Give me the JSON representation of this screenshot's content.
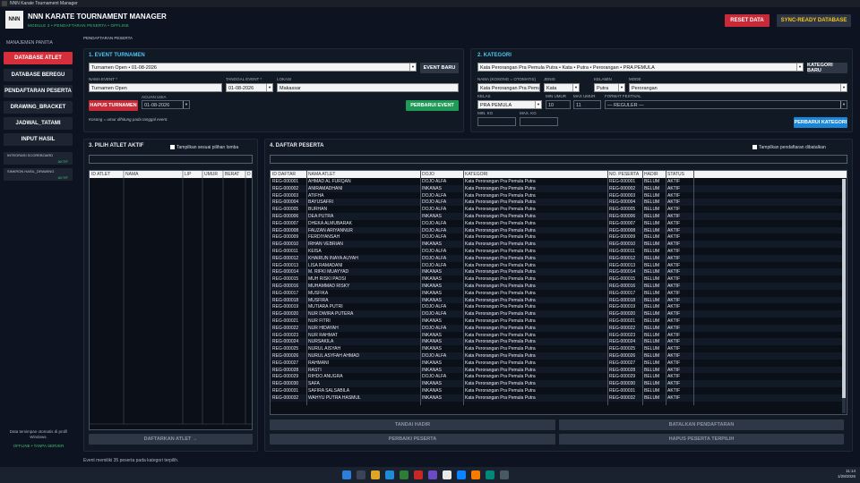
{
  "window_title": "NNN Karate Tournament Manager",
  "logo_text": "NNN",
  "app_title": "NNN KARATE TOURNAMENT MANAGER",
  "app_subtitle": "MODULE 3 • PENDAFTARAN PESERTA • OFFLINE",
  "header_buttons": {
    "reset": "RESET DATA",
    "sync": "SYNC-READY DATABASE"
  },
  "sidebar": {
    "section": "MANAJEMEN PANITIA",
    "items": [
      "DATABASE ATLET",
      "DATABASE BEREGU",
      "PENDAFTARAN PESERTA",
      "DRAWING_BRACKET",
      "JADWAL_TATAMI",
      "INPUT HASIL"
    ],
    "small_items": [
      {
        "label": "INTEGRASI SCOREBOARD",
        "status": "AKTIF"
      },
      {
        "label": "SINKRON HASIL_DRAWING",
        "status": "AKTIF"
      }
    ],
    "footer": "Data tersimpan otomatis di profil Windows.",
    "footer_status": "OFFLINE • TANPA SERVER"
  },
  "breadcrumb": "PENDAFTARAN PESERTA",
  "event": {
    "title": "1. EVENT TURNAMEN",
    "selected": "Turnamen Open • 01-08-2026",
    "btn_new": "EVENT BARU",
    "lbl_name": "NAMA EVENT *",
    "lbl_date": "TANGGAL EVENT *",
    "lbl_loc": "LOKASI",
    "name": "Turnamen Open",
    "date": "01-08-2026",
    "location": "Makassar",
    "btn_delete": "HAPUS TURNAMEN",
    "lbl_age": "ACUAN USIA",
    "age_ref": "01-08-2026",
    "btn_update": "PERBARUI EVENT",
    "hint": "Kosong = umur dihitung pada tanggal event."
  },
  "kategori": {
    "title": "2. KATEGORI",
    "selected": "Kata Perorangan Pra Pemula Putra • Kata • Putra • Perorangan • PRA PEMULA",
    "btn_new": "KATEGORI BARU",
    "lbl_name": "NAMA (KOSONG = OTOMATIS)",
    "lbl_type": "JENIS",
    "lbl_gender": "KELAMIN",
    "lbl_mode": "MODE",
    "name": "Kata Perorangan Pra Pemula",
    "type": "Kata",
    "gender": "Putra",
    "mode": "Perorangan",
    "lbl_kelas": "KELAS",
    "lbl_min_age": "MIN UMUR",
    "lbl_max_age": "MAX UMUR",
    "lbl_format": "FORMAT FESTIVAL",
    "kelas": "PRA PEMULA",
    "min_age": "10",
    "max_age": "11",
    "format": "— REGULER —",
    "lbl_min_kg": "MIN. KG",
    "lbl_max_kg": "MAX. KG",
    "btn_update": "PERBARUI KATEGORI"
  },
  "pilih": {
    "title": "3. PILIH ATLET AKTIF",
    "check_label": "Tampilkan sesuai pilihan lomba",
    "columns": [
      "ID ATLET",
      "NAMA",
      "L/P",
      "UMUR",
      "BERAT",
      "D"
    ],
    "btn_register": "DAFTARKAN ATLET →"
  },
  "daftar": {
    "title": "4. DAFTAR PESERTA",
    "check_label": "Tampilkan pendaftaran dibatalkan",
    "columns": [
      "ID DAFTAR",
      "NAMA ATLET",
      "DOJO",
      "KATEGORI",
      "NO. PESERTA",
      "HADIR",
      "STATUS"
    ],
    "rows": [
      [
        "REG-000001",
        "AHMAD AL FURQAN",
        "DOJO ALFA",
        "Kata Perorangan Pra Pemula Putra",
        "REG-000001",
        "BELUM",
        "AKTIF"
      ],
      [
        "REG-000002",
        "ANIRAMADHANI",
        "INKANAS",
        "Kata Perorangan Pra Pemula Putra",
        "REG-000002",
        "BELUM",
        "AKTIF"
      ],
      [
        "REG-000003",
        "ATIFHA",
        "DOJO ALFA",
        "Kata Perorangan Pra Pemula Putra",
        "REG-000003",
        "BELUM",
        "AKTIF"
      ],
      [
        "REG-000004",
        "BAYUSAFRI",
        "DOJO ALFA",
        "Kata Perorangan Pra Pemula Putra",
        "REG-000004",
        "BELUM",
        "AKTIF"
      ],
      [
        "REG-000005",
        "BURHAN",
        "DOJO ALFA",
        "Kata Perorangan Pra Pemula Putra",
        "REG-000005",
        "BELUM",
        "AKTIF"
      ],
      [
        "REG-000006",
        "DEA PUTRA",
        "INKANAS",
        "Kata Perorangan Pra Pemula Putra",
        "REG-000006",
        "BELUM",
        "AKTIF"
      ],
      [
        "REG-000007",
        "DHEKA ALMUBARAK",
        "DOJO ALFA",
        "Kata Perorangan Pra Pemula Putra",
        "REG-000007",
        "BELUM",
        "AKTIF"
      ],
      [
        "REG-000008",
        "FAUZAN ARIYANNUR",
        "DOJO ALFA",
        "Kata Perorangan Pra Pemula Putra",
        "REG-000008",
        "BELUM",
        "AKTIF"
      ],
      [
        "REG-000009",
        "FERDIYANSAH",
        "DOJO ALFA",
        "Kata Perorangan Pra Pemula Putra",
        "REG-000009",
        "BELUM",
        "AKTIF"
      ],
      [
        "REG-000010",
        "IRHAN VEBRIAN",
        "INKANAS",
        "Kata Perorangan Pra Pemula Putra",
        "REG-000010",
        "BELUM",
        "AKTIF"
      ],
      [
        "REG-000011",
        "KEISA",
        "DOJO ALFA",
        "Kata Perorangan Pra Pemula Putra",
        "REG-000011",
        "BELUM",
        "AKTIF"
      ],
      [
        "REG-000012",
        "KHAIRUN INAYA AUYAH",
        "DOJO ALFA",
        "Kata Perorangan Pra Pemula Putra",
        "REG-000012",
        "BELUM",
        "AKTIF"
      ],
      [
        "REG-000013",
        "LISA RAMADANI",
        "DOJO ALFA",
        "Kata Perorangan Pra Pemula Putra",
        "REG-000013",
        "BELUM",
        "AKTIF"
      ],
      [
        "REG-000014",
        "M. RIFKI MUAYYAD",
        "INKANAS",
        "Kata Perorangan Pra Pemula Putra",
        "REG-000014",
        "BELUM",
        "AKTIF"
      ],
      [
        "REG-000015",
        "MUH RISKI PAOSI",
        "INKANAS",
        "Kata Perorangan Pra Pemula Putra",
        "REG-000015",
        "BELUM",
        "AKTIF"
      ],
      [
        "REG-000016",
        "MUHAMMAD RISKY",
        "INKANAS",
        "Kata Perorangan Pra Pemula Putra",
        "REG-000016",
        "BELUM",
        "AKTIF"
      ],
      [
        "REG-000017",
        "MUSFIKA",
        "INKANAS",
        "Kata Perorangan Pra Pemula Putra",
        "REG-000017",
        "BELUM",
        "AKTIF"
      ],
      [
        "REG-000018",
        "MUSFIRA",
        "INKANAS",
        "Kata Perorangan Pra Pemula Putra",
        "REG-000018",
        "BELUM",
        "AKTIF"
      ],
      [
        "REG-000019",
        "MUTIARA PUTRI",
        "DOJO ALFA",
        "Kata Perorangan Pra Pemula Putra",
        "REG-000019",
        "BELUM",
        "AKTIF"
      ],
      [
        "REG-000020",
        "NUR DWIRA PUTERA",
        "DOJO ALFA",
        "Kata Perorangan Pra Pemula Putra",
        "REG-000020",
        "BELUM",
        "AKTIF"
      ],
      [
        "REG-000021",
        "NUR FITRI",
        "INKANAS",
        "Kata Perorangan Pra Pemula Putra",
        "REG-000021",
        "BELUM",
        "AKTIF"
      ],
      [
        "REG-000022",
        "NUR HIDAYAH",
        "DOJO ALFA",
        "Kata Perorangan Pra Pemula Putra",
        "REG-000022",
        "BELUM",
        "AKTIF"
      ],
      [
        "REG-000023",
        "NUR RAHMAT",
        "INKANAS",
        "Kata Perorangan Pra Pemula Putra",
        "REG-000023",
        "BELUM",
        "AKTIF"
      ],
      [
        "REG-000024",
        "NURSAKILA",
        "INKANAS",
        "Kata Perorangan Pra Pemula Putra",
        "REG-000024",
        "BELUM",
        "AKTIF"
      ],
      [
        "REG-000025",
        "NURUL AISYAH",
        "INKANAS",
        "Kata Perorangan Pra Pemula Putra",
        "REG-000025",
        "BELUM",
        "AKTIF"
      ],
      [
        "REG-000026",
        "NURUL ASYFAH AHMAD",
        "DOJO ALFA",
        "Kata Perorangan Pra Pemula Putra",
        "REG-000026",
        "BELUM",
        "AKTIF"
      ],
      [
        "REG-000027",
        "RAHMANI",
        "INKANAS",
        "Kata Perorangan Pra Pemula Putra",
        "REG-000027",
        "BELUM",
        "AKTIF"
      ],
      [
        "REG-000028",
        "RASTI",
        "INKANAS",
        "Kata Perorangan Pra Pemula Putra",
        "REG-000028",
        "BELUM",
        "AKTIF"
      ],
      [
        "REG-000029",
        "RIHDO ANUGRA",
        "DOJO ALFA",
        "Kata Perorangan Pra Pemula Putra",
        "REG-000029",
        "BELUM",
        "AKTIF"
      ],
      [
        "REG-000030",
        "SAFA",
        "INKANAS",
        "Kata Perorangan Pra Pemula Putra",
        "REG-000030",
        "BELUM",
        "AKTIF"
      ],
      [
        "REG-000031",
        "SAFIRA SALSABILA",
        "INKANAS",
        "Kata Perorangan Pra Pemula Putra",
        "REG-000031",
        "BELUM",
        "AKTIF"
      ],
      [
        "REG-000032",
        "WAHYU PUTRA HASMUL",
        "INKANAS",
        "Kata Perorangan Pra Pemula Putra",
        "REG-000032",
        "BELUM",
        "AKTIF"
      ]
    ],
    "btn_hadir": "TANDAI HADIR",
    "btn_batal": "BATALKAN PENDAFTARAN",
    "btn_perbaiki": "PERBAIKI PESERTA",
    "btn_hapus": "HAPUS PESERTA TERPILIH"
  },
  "status_text": "Event memiliki 35 peserta pada kategori terpilih.",
  "taskbar": {
    "time": "11:14",
    "date": "1/28/2026"
  },
  "colors": {
    "accent_red": "#d72e3b",
    "accent_blue": "#4ec3f0",
    "accent_green": "#1f9a57"
  }
}
